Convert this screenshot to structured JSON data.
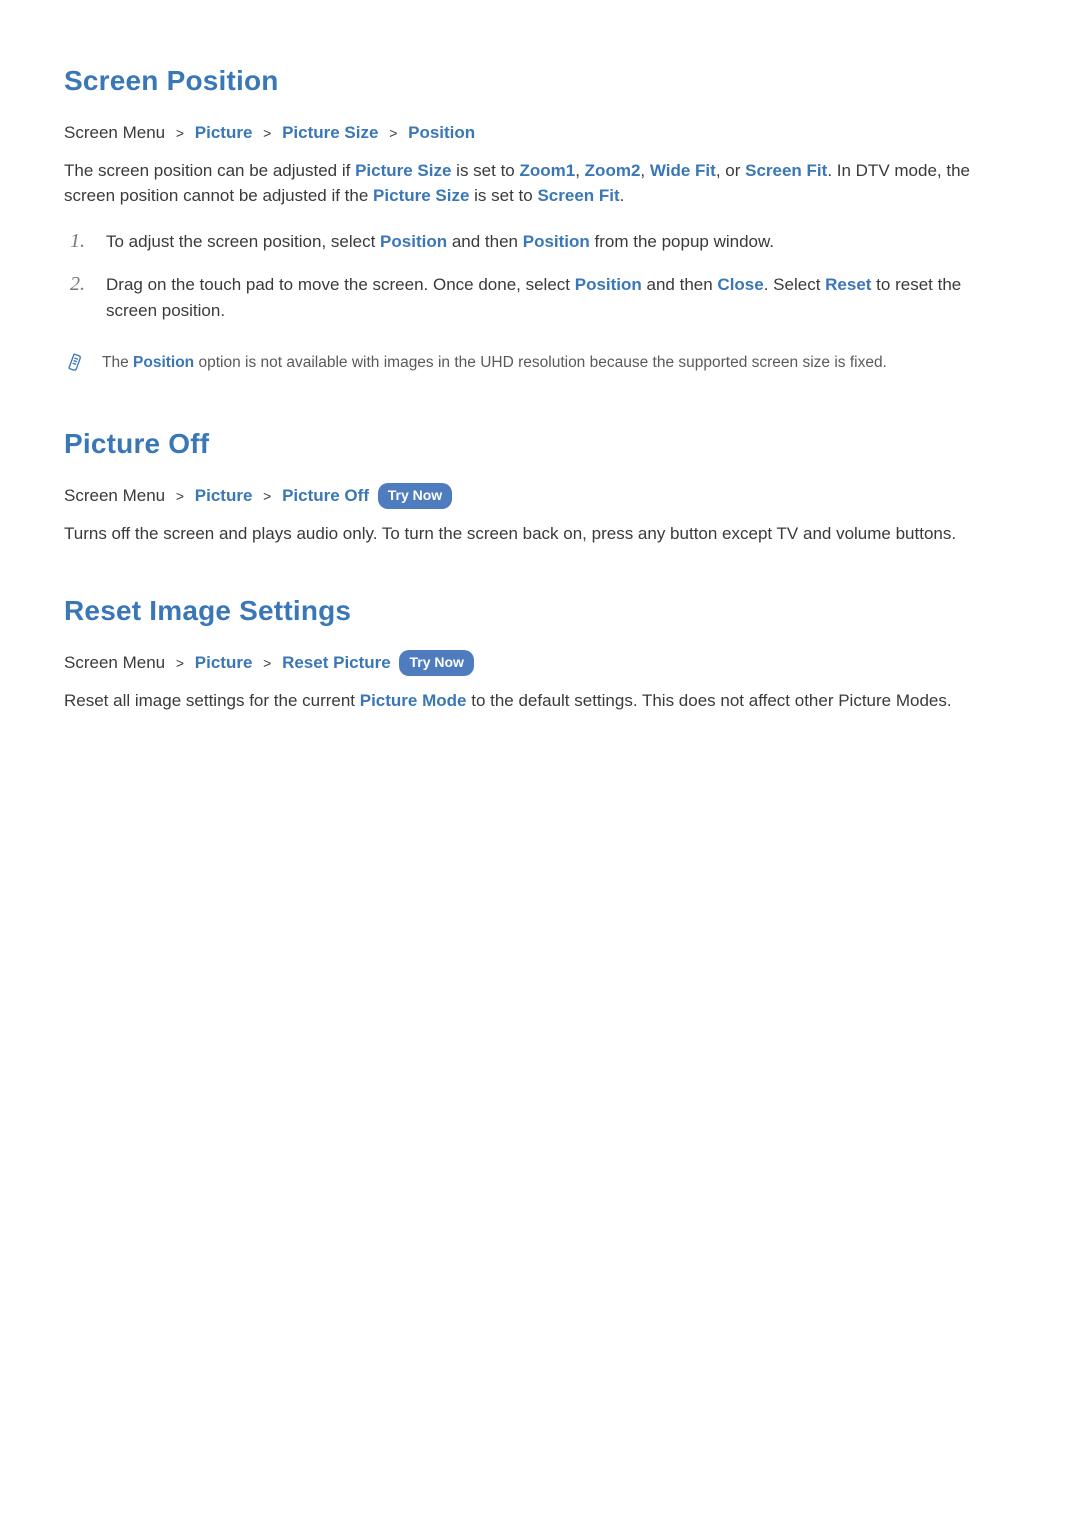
{
  "sections": {
    "screen_position": {
      "title": "Screen Position",
      "breadcrumb": {
        "root": "Screen Menu",
        "seg1": "Picture",
        "seg2": "Picture Size",
        "seg3": "Position"
      },
      "intro": {
        "t1": "The screen position can be adjusted if ",
        "picture_size": "Picture Size",
        "t2": " is set to ",
        "zoom1": "Zoom1",
        "comma1": ", ",
        "zoom2": "Zoom2",
        "comma2": ", ",
        "wide_fit": "Wide Fit",
        "comma3": ", or ",
        "screen_fit": "Screen Fit",
        "t3": ". In DTV mode, the screen position cannot be adjusted if the ",
        "picture_size2": "Picture Size",
        "t4": " is set to ",
        "screen_fit2": "Screen Fit",
        "t5": "."
      },
      "steps": [
        {
          "num": "1.",
          "s1": "To adjust the screen position, select ",
          "position1": "Position",
          "s2": " and then ",
          "position2": "Position",
          "s3": " from the popup window."
        },
        {
          "num": "2.",
          "s1": "Drag on the touch pad to move the screen. Once done, select ",
          "position1": "Position",
          "s2": " and then ",
          "close": "Close",
          "s3": ". Select ",
          "reset": "Reset",
          "s4": " to reset the screen position."
        }
      ],
      "note": {
        "n1": "The ",
        "position": "Position",
        "n2": " option is not available with images in the UHD resolution because the supported screen size is fixed."
      }
    },
    "picture_off": {
      "title": "Picture Off",
      "breadcrumb": {
        "root": "Screen Menu",
        "seg1": "Picture",
        "seg2": "Picture Off",
        "try_now": "Try Now"
      },
      "body": "Turns off the screen and plays audio only. To turn the screen back on, press any button except TV and volume buttons."
    },
    "reset_image": {
      "title": "Reset Image Settings",
      "breadcrumb": {
        "root": "Screen Menu",
        "seg1": "Picture",
        "seg2": "Reset Picture",
        "try_now": "Try Now"
      },
      "body": {
        "b1": "Reset all image settings for the current ",
        "picture_mode": "Picture Mode",
        "b2": " to the default settings. This does not affect other Picture Modes."
      }
    }
  }
}
